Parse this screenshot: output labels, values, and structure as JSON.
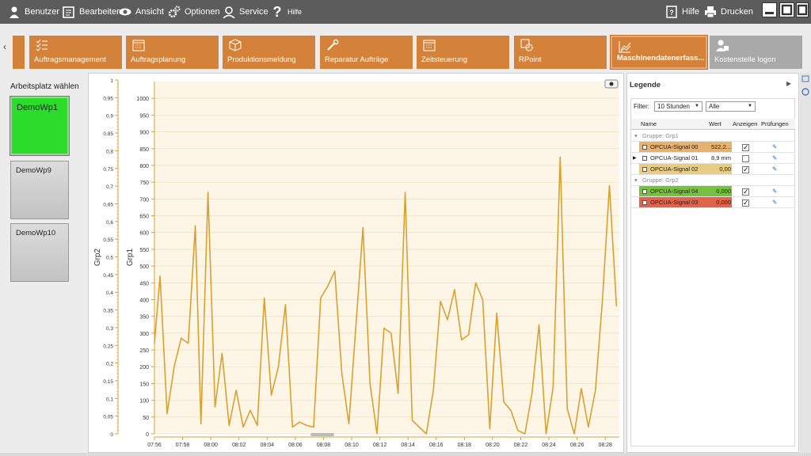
{
  "toolbar": {
    "left_items": [
      {
        "label": "Benutzer",
        "icon": "user-icon"
      },
      {
        "label": "Bearbeiten",
        "icon": "edit-icon"
      },
      {
        "label": "Ansicht",
        "icon": "eye-icon"
      },
      {
        "label": "Optionen",
        "icon": "gears-icon"
      },
      {
        "label": "Service",
        "icon": "service-icon"
      },
      {
        "label": "Hilfe",
        "icon": "question-icon"
      }
    ],
    "right_items": [
      {
        "label": "Hilfe",
        "icon": "help-book-icon"
      },
      {
        "label": "Drucken",
        "icon": "printer-icon"
      }
    ]
  },
  "tabs": [
    {
      "label": "Auftragsmanagement",
      "icon": "checklist-icon",
      "state": "normal"
    },
    {
      "label": "Auftragsplanung",
      "icon": "calendar-icon",
      "state": "normal"
    },
    {
      "label": "Produktionsmeldung",
      "icon": "box-icon",
      "state": "normal"
    },
    {
      "label": "Reparatur Aufträge",
      "icon": "repair-icon",
      "state": "normal"
    },
    {
      "label": "Zeitsteuerung",
      "icon": "calendar-icon",
      "state": "normal"
    },
    {
      "label": "RPoint",
      "icon": "rpoint-icon",
      "state": "normal"
    },
    {
      "label": "Maschinendatenerfass...",
      "icon": "chart-icon",
      "state": "active"
    },
    {
      "label": "Kostenstelle logon",
      "icon": "user-card-icon",
      "state": "disabled"
    }
  ],
  "workstations": {
    "title": "Arbeitsplatz wählen",
    "items": [
      {
        "label": "DemoWp1",
        "active": true
      },
      {
        "label": "DemoWp9",
        "active": false
      },
      {
        "label": "DemoWp10",
        "active": false
      }
    ]
  },
  "legend": {
    "title": "Legende",
    "filter_label": "Filter:",
    "filter_value": "10 Stunden",
    "filter2_value": "Alle",
    "columns": [
      "Name",
      "Wert",
      "Anzeigen",
      "Prüfungen"
    ],
    "rows": [
      {
        "type": "group",
        "label": "Gruppe: Grp1"
      },
      {
        "type": "signal",
        "name": "OPCUA-Signal 00",
        "value": "522,2...",
        "checked": true,
        "bg": "#e7b16e",
        "selected": false
      },
      {
        "type": "signal",
        "name": "OPCUA-Signal 01",
        "value": "8,9 mm",
        "checked": false,
        "bg": "#ffffff",
        "selected": true
      },
      {
        "type": "signal",
        "name": "OPCUA-Signal 02",
        "value": "0,00",
        "checked": true,
        "bg": "#e8cc82",
        "selected": false
      },
      {
        "type": "group",
        "label": "Gruppe: Grp2"
      },
      {
        "type": "signal",
        "name": "OPCUA-Signal 04",
        "value": "0,000",
        "checked": true,
        "bg": "#78c040",
        "selected": false
      },
      {
        "type": "signal",
        "name": "OPCUA-Signal 03",
        "value": "0,000",
        "checked": true,
        "bg": "#e2634a",
        "selected": false
      }
    ]
  },
  "chart_data": {
    "type": "line",
    "line_color": "#d9a030",
    "background": "#fdf6e6",
    "y_axes": [
      {
        "label": "Grp2",
        "range": [
          0,
          1
        ],
        "ticks": [
          "0",
          "0,05",
          "0,1",
          "0,15",
          "0,2",
          "0,25",
          "0,3",
          "0,35",
          "0,4",
          "0,45",
          "0,5",
          "0,55",
          "0,6",
          "0,65",
          "0,7",
          "0,75",
          "0,8",
          "0,85",
          "0,9",
          "0,95",
          "1"
        ]
      },
      {
        "label": "Grp1",
        "range": [
          0,
          1000
        ],
        "ticks": [
          "0",
          "50",
          "100",
          "150",
          "200",
          "250",
          "300",
          "350",
          "400",
          "450",
          "500",
          "550",
          "600",
          "650",
          "700",
          "750",
          "800",
          "850",
          "900",
          "950",
          "1000"
        ]
      }
    ],
    "x_ticks": [
      "07:56",
      "07:58",
      "08:00",
      "08:02",
      "08:04",
      "08:06",
      "08:08",
      "08:10",
      "08:12",
      "08:14",
      "08:16",
      "08:18",
      "08:20",
      "08:22",
      "08:24",
      "08:26",
      "08:28"
    ],
    "x_range_minutes": [
      0,
      33
    ],
    "series": [
      {
        "axis": "Grp1",
        "points": [
          [
            0,
            270
          ],
          [
            0.4,
            470
          ],
          [
            0.9,
            60
          ],
          [
            1.4,
            200
          ],
          [
            1.9,
            285
          ],
          [
            2.4,
            270
          ],
          [
            2.9,
            620
          ],
          [
            3.3,
            30
          ],
          [
            3.8,
            720
          ],
          [
            4.3,
            80
          ],
          [
            4.8,
            240
          ],
          [
            5.3,
            25
          ],
          [
            5.8,
            130
          ],
          [
            6.3,
            20
          ],
          [
            6.8,
            70
          ],
          [
            7.3,
            25
          ],
          [
            7.8,
            405
          ],
          [
            8.3,
            115
          ],
          [
            8.8,
            200
          ],
          [
            9.3,
            385
          ],
          [
            9.8,
            20
          ],
          [
            10.3,
            35
          ],
          [
            10.8,
            25
          ],
          [
            11.3,
            20
          ],
          [
            11.8,
            405
          ],
          [
            12.3,
            440
          ],
          [
            12.8,
            485
          ],
          [
            13.3,
            180
          ],
          [
            13.8,
            30
          ],
          [
            14.8,
            615
          ],
          [
            15.3,
            150
          ],
          [
            15.8,
            0
          ],
          [
            16.3,
            315
          ],
          [
            16.8,
            300
          ],
          [
            17.3,
            120
          ],
          [
            17.8,
            720
          ],
          [
            18.3,
            40
          ],
          [
            18.8,
            20
          ],
          [
            19.3,
            0
          ],
          [
            19.8,
            130
          ],
          [
            20.3,
            395
          ],
          [
            20.8,
            340
          ],
          [
            21.3,
            430
          ],
          [
            21.8,
            280
          ],
          [
            22.3,
            295
          ],
          [
            22.8,
            450
          ],
          [
            23.3,
            400
          ],
          [
            23.8,
            15
          ],
          [
            24.3,
            360
          ],
          [
            24.8,
            95
          ],
          [
            25.3,
            70
          ],
          [
            25.8,
            10
          ],
          [
            26.3,
            0
          ],
          [
            26.8,
            120
          ],
          [
            27.3,
            325
          ],
          [
            27.8,
            0
          ],
          [
            28.3,
            140
          ],
          [
            28.8,
            825
          ],
          [
            29.3,
            75
          ],
          [
            29.8,
            0
          ],
          [
            30.3,
            135
          ],
          [
            30.8,
            20
          ],
          [
            31.3,
            130
          ],
          [
            31.8,
            400
          ],
          [
            32.3,
            740
          ],
          [
            32.8,
            380
          ]
        ]
      }
    ]
  }
}
